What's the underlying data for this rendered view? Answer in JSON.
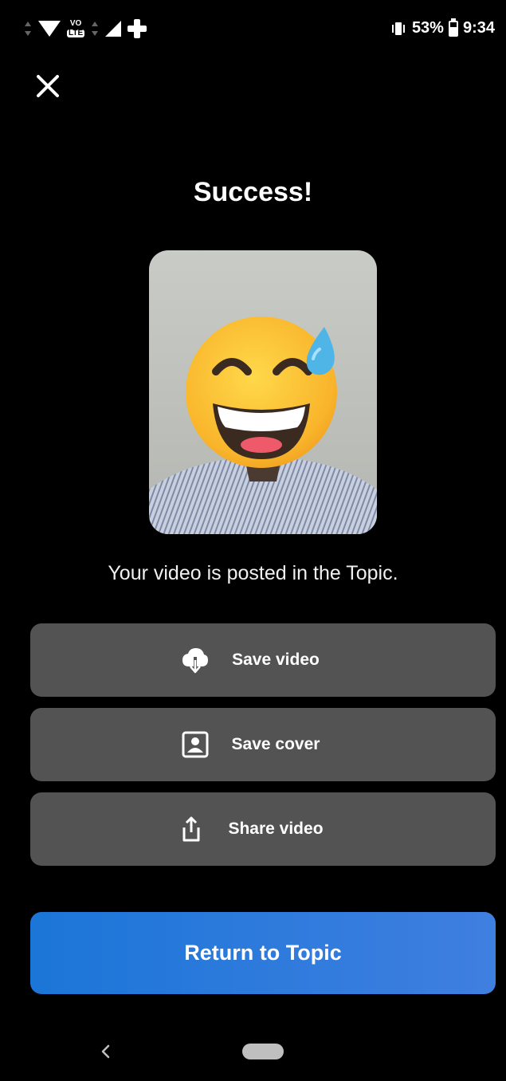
{
  "status_bar": {
    "battery_percent": "53%",
    "time": "9:34",
    "lte_top": "VO",
    "lte_bottom": "LTE"
  },
  "header": {
    "close_icon": "close-icon"
  },
  "main": {
    "title": "Success!",
    "subtitle": "Your video is posted in the Topic."
  },
  "actions": [
    {
      "label": "Save video",
      "icon": "cloud-download-icon"
    },
    {
      "label": "Save cover",
      "icon": "portrait-icon"
    },
    {
      "label": "Share video",
      "icon": "share-icon"
    }
  ],
  "primary_button": {
    "label": "Return to Topic"
  },
  "colors": {
    "background": "#000000",
    "action_button": "#535353",
    "primary_start": "#1b76d8",
    "primary_end": "#3f7fe0"
  }
}
